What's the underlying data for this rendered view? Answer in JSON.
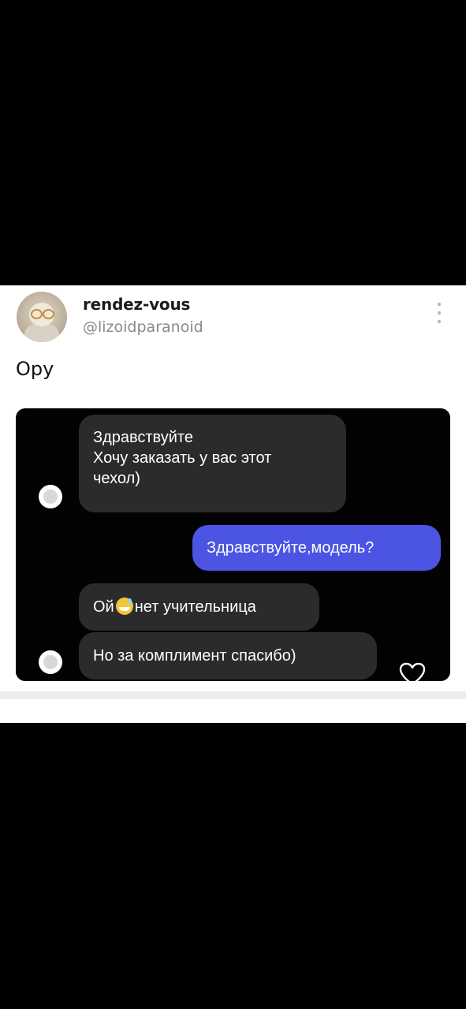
{
  "post": {
    "author": {
      "display_name": "rendez-vous",
      "handle": "@lizoidparanoid"
    },
    "text": "Ору",
    "image": {
      "messages": [
        {
          "direction": "incoming",
          "lines": [
            "Здравствуйте",
            "Хочу заказать у вас этот",
            "чехол)"
          ]
        },
        {
          "direction": "outgoing",
          "text": "Здравствуйте,модель?"
        },
        {
          "direction": "incoming",
          "before_emoji": "Ой",
          "after_emoji": "нет учительница"
        },
        {
          "direction": "incoming",
          "text": "Но за комплимент спасибо)"
        }
      ],
      "icons": {
        "emoji": "sweat-smile-emoji-icon",
        "reaction": "heart-icon"
      }
    }
  },
  "colors": {
    "outgoing_bubble": "#4b54e3",
    "incoming_bubble": "#2b2b2e",
    "background": "#000000",
    "card": "#ffffff",
    "handle_text": "#8a8a8a"
  }
}
